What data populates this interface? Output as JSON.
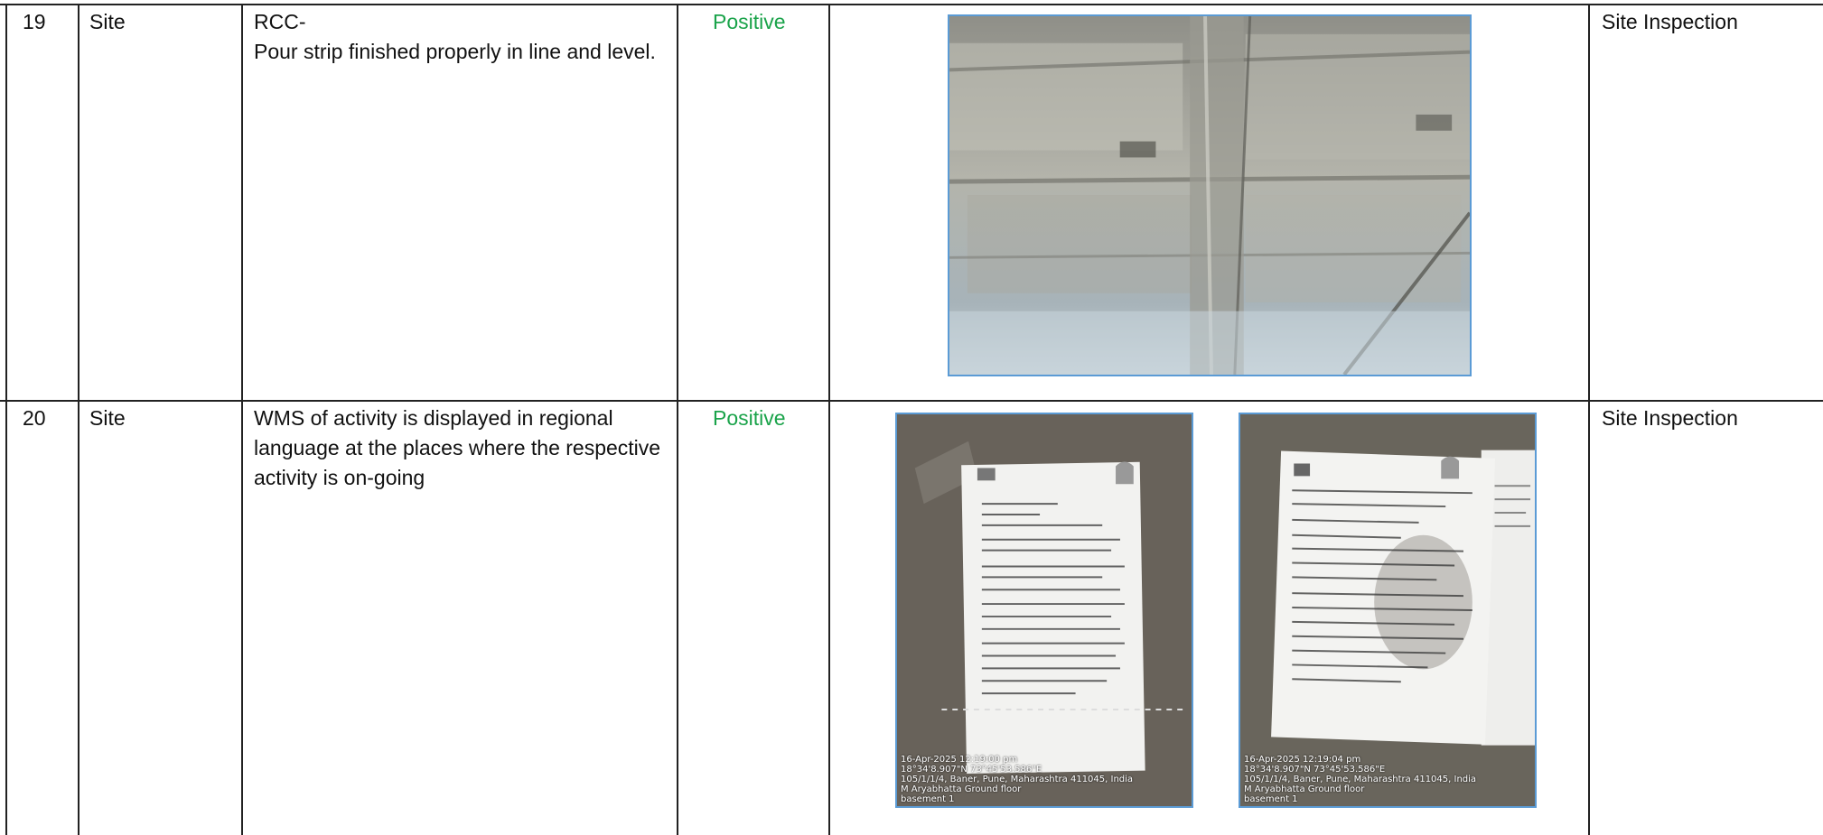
{
  "rows": [
    {
      "sr": "19",
      "location": "Site",
      "observation_title": "RCC-",
      "observation_body": "Pour strip finished properly in line and level.",
      "status": "Positive",
      "source": "Site Inspection",
      "photos": [
        {
          "description": "Concrete slab soffit with pour strip"
        }
      ]
    },
    {
      "sr": "20",
      "location": "Site",
      "observation_title": "",
      "observation_body": "WMS of activity is displayed in regional language at the places where the respective activity is on-going",
      "status": "Positive",
      "source": "Site Inspection",
      "photos": [
        {
          "stamp": [
            "16-Apr-2025 12:19:00 pm",
            "18°34'8.907\"N 73°45'53.586\"E",
            "105/1/1/4, Baner, Pune, Maharashtra 411045, India",
            "M Aryabhatta Ground floor",
            "basement 1"
          ]
        },
        {
          "stamp": [
            "16-Apr-2025 12:19:04 pm",
            "18°34'8.907\"N 73°45'53.586\"E",
            "105/1/1/4, Baner, Pune, Maharashtra 411045, India",
            "M Aryabhatta Ground floor",
            "basement 1"
          ]
        }
      ]
    }
  ],
  "colors": {
    "status_positive": "#1aa34a",
    "photo_border": "#5b9bd5",
    "grid": "#222222"
  }
}
